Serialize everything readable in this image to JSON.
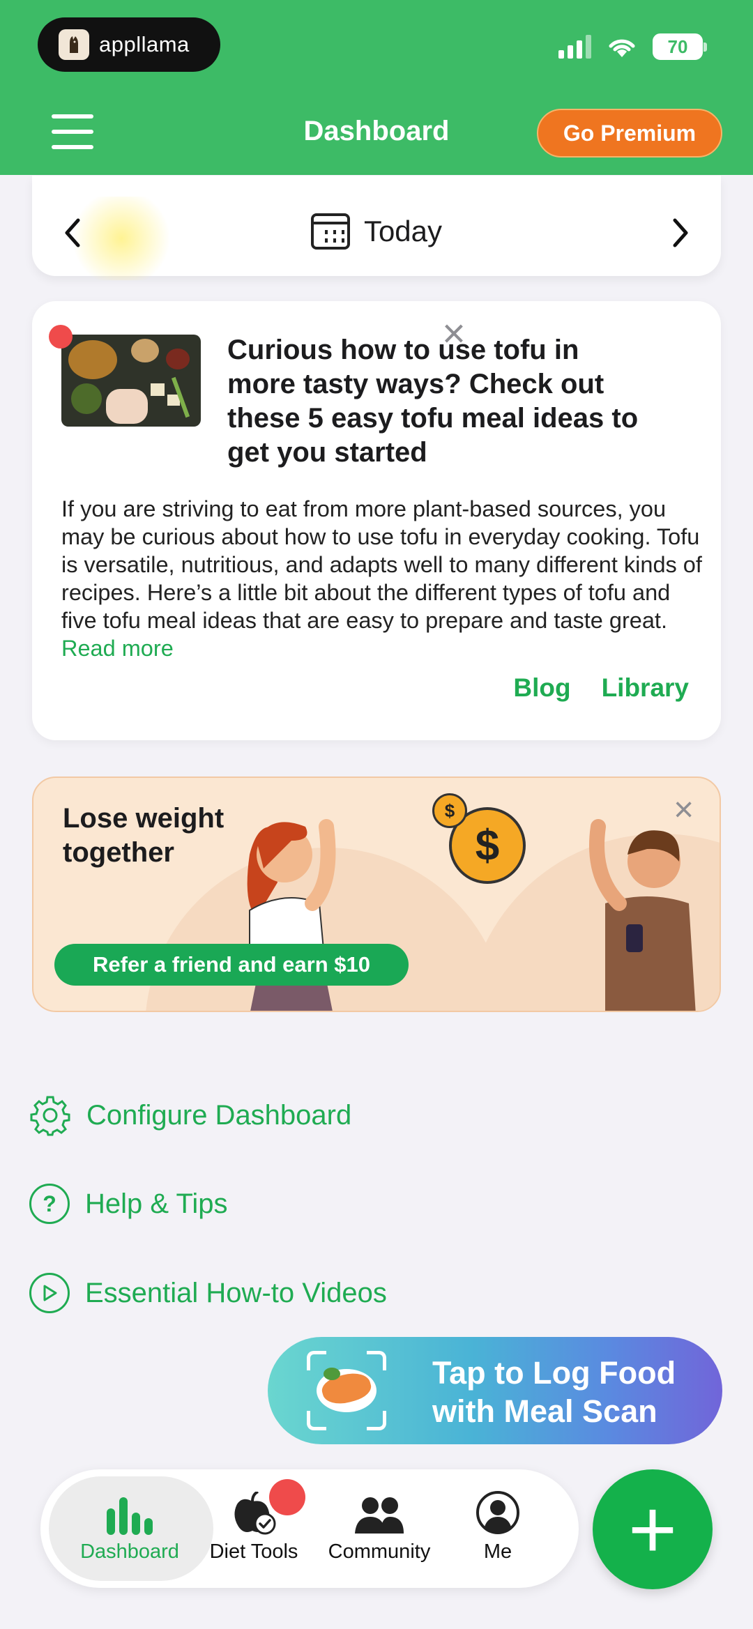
{
  "status_bar": {
    "app_pill_label": "appllama",
    "battery": "70"
  },
  "header": {
    "title": "Dashboard",
    "premium_label": "Go Premium"
  },
  "date_nav": {
    "label": "Today"
  },
  "article": {
    "title": "Curious how to use tofu in more tasty ways? Check out these 5 easy tofu meal ideas to get you started",
    "body": "If you are striving to eat from more plant-based sources, you may be curious about how to use tofu in everyday cooking. Tofu is versatile, nutritious, and adapts well to many different kinds of recipes. Here’s a little bit about the different types of tofu and five tofu meal ideas that are easy to prepare and taste great.",
    "read_more": "Read more",
    "link_blog": "Blog",
    "link_library": "Library",
    "close_symbol": "×"
  },
  "referral": {
    "title_line1": "Lose weight",
    "title_line2": "together",
    "button_label": "Refer a friend and earn $10",
    "close_symbol": "×",
    "coin_big": "$",
    "coin_small": "$"
  },
  "links": {
    "configure": "Configure Dashboard",
    "help": "Help & Tips",
    "help_icon": "?",
    "videos": "Essential How-to Videos"
  },
  "meal_scan": {
    "line1": "Tap to Log Food",
    "line2": "with Meal Scan"
  },
  "bottom_nav": {
    "items": [
      {
        "label": "Dashboard"
      },
      {
        "label": "Diet Tools"
      },
      {
        "label": "Community"
      },
      {
        "label": "Me"
      }
    ],
    "fab_symbol": "+"
  },
  "colors": {
    "header_green": "#3dbb66",
    "accent_green": "#1fab52",
    "premium_orange": "#ef7520",
    "badge_red": "#ef4b4b"
  }
}
